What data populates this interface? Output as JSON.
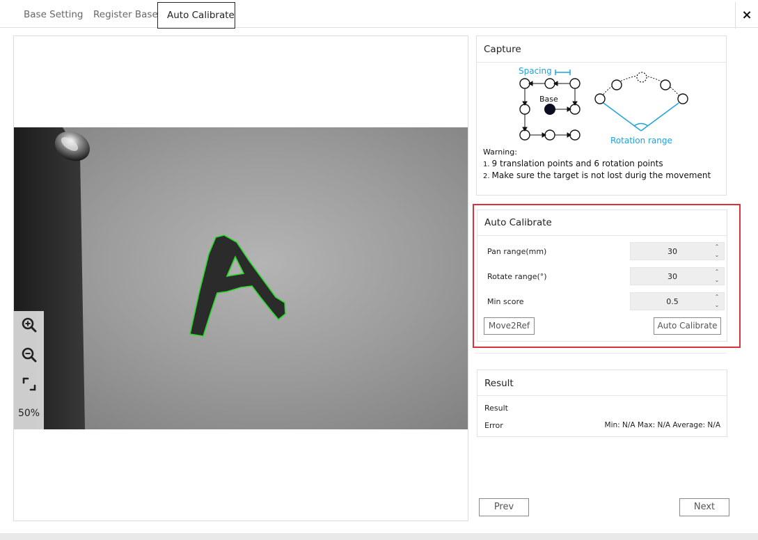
{
  "tabs": [
    {
      "label": "Base Setting"
    },
    {
      "label": "Register Base"
    },
    {
      "label": "Auto Calibrate"
    }
  ],
  "close_label": "×",
  "viewer": {
    "zoom_level": "50%",
    "overlay_color": "#22dd22"
  },
  "capture": {
    "title": "Capture",
    "diagram": {
      "spacing_label": "Spacing",
      "base_label": "Base",
      "rotation_label": "Rotation range",
      "accent_color": "#1aa3e0"
    },
    "warning_title": "Warning:",
    "warnings": [
      {
        "num": "1.",
        "text": "9 translation points and 6 rotation points"
      },
      {
        "num": "2.",
        "text": "Make sure the target is not lost durig the movement"
      }
    ]
  },
  "auto_calibrate": {
    "title": "Auto Calibrate",
    "fields": [
      {
        "label": "Pan range(mm)",
        "value": "30"
      },
      {
        "label": "Rotate range(°)",
        "value": "30"
      },
      {
        "label": "Min score",
        "value": "0.5"
      }
    ],
    "move_button": "Move2Ref",
    "calibrate_button": "Auto Calibrate",
    "highlight_color": "#d9333a"
  },
  "result": {
    "title": "Result",
    "result_label": "Result",
    "error_label": "Error",
    "error_value": "Min: N/A  Max: N/A  Average: N/A"
  },
  "nav": {
    "prev": "Prev",
    "next": "Next"
  }
}
